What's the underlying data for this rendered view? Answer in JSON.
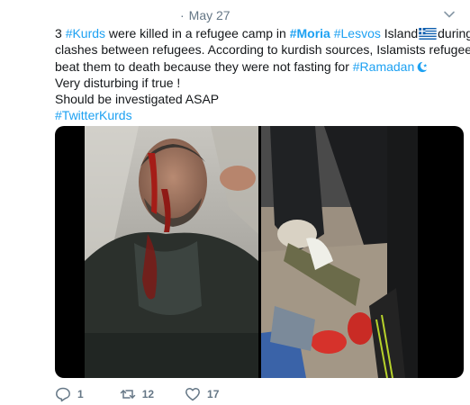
{
  "tweet": {
    "date_sep": "·",
    "date": "May 27",
    "lines": [
      [
        {
          "t": "3 "
        },
        {
          "t": "#Kurds",
          "cls": "hashtag"
        },
        {
          "t": " were killed in a refugee camp in "
        },
        {
          "t": "#Moria",
          "cls": "hashtag bold"
        },
        {
          "t": " "
        },
        {
          "t": "#Lesvos",
          "cls": "hashtag"
        },
        {
          "t": " Island"
        },
        {
          "flag": "greece-flag"
        },
        {
          "t": "during"
        }
      ],
      [
        {
          "t": "clashes between refugees. According to kurdish sources, Islamists refugees"
        }
      ],
      [
        {
          "t": "beat them to death because they were not fasting for "
        },
        {
          "t": "#Ramadan",
          "cls": "hashtag"
        },
        {
          "moon": "crescent-moon-icon"
        }
      ],
      [
        {
          "t": "Very disturbing if true !"
        }
      ],
      [
        {
          "t": "Should be investigated ASAP"
        }
      ],
      [
        {
          "t": "#TwitterKurds",
          "cls": "hashtag"
        }
      ]
    ]
  },
  "actions": {
    "reply_count": "1",
    "retweet_count": "12",
    "like_count": "17"
  },
  "icons": {
    "caret": "chevron-down-icon",
    "reply": "reply-icon",
    "retweet": "retweet-icon",
    "like": "heart-icon"
  },
  "colors": {
    "link": "#1da1f2",
    "meta": "#657786",
    "text": "#14171a"
  }
}
